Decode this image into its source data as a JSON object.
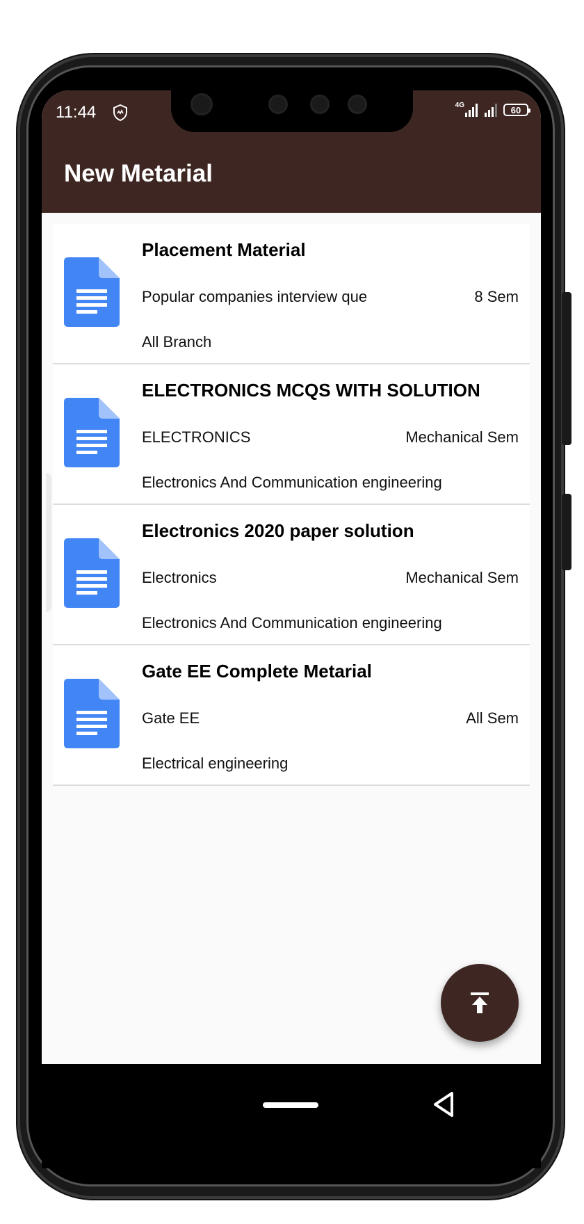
{
  "status_bar": {
    "time": "11:44",
    "network": "4G",
    "battery": "60"
  },
  "app_bar": {
    "title": "New Metarial"
  },
  "items": [
    {
      "title": "Placement Material",
      "subject": "Popular companies interview que",
      "semester": "8 Sem",
      "branch": "All Branch"
    },
    {
      "title": "ELECTRONICS MCQS WITH SOLUTION",
      "subject": "ELECTRONICS",
      "semester": "Mechanical Sem",
      "branch": "Electronics And Communication engineering"
    },
    {
      "title": "Electronics 2020 paper solution",
      "subject": "Electronics",
      "semester": "Mechanical Sem",
      "branch": "Electronics And Communication engineering"
    },
    {
      "title": "Gate EE Complete Metarial",
      "subject": "Gate EE",
      "semester": "All Sem",
      "branch": "Electrical engineering"
    }
  ],
  "colors": {
    "app_bar": "#3e2723",
    "doc_icon": "#4285f4",
    "fab": "#3e2723"
  },
  "icons": {
    "fab": "vertical-align-top-icon",
    "document": "google-doc-icon"
  }
}
